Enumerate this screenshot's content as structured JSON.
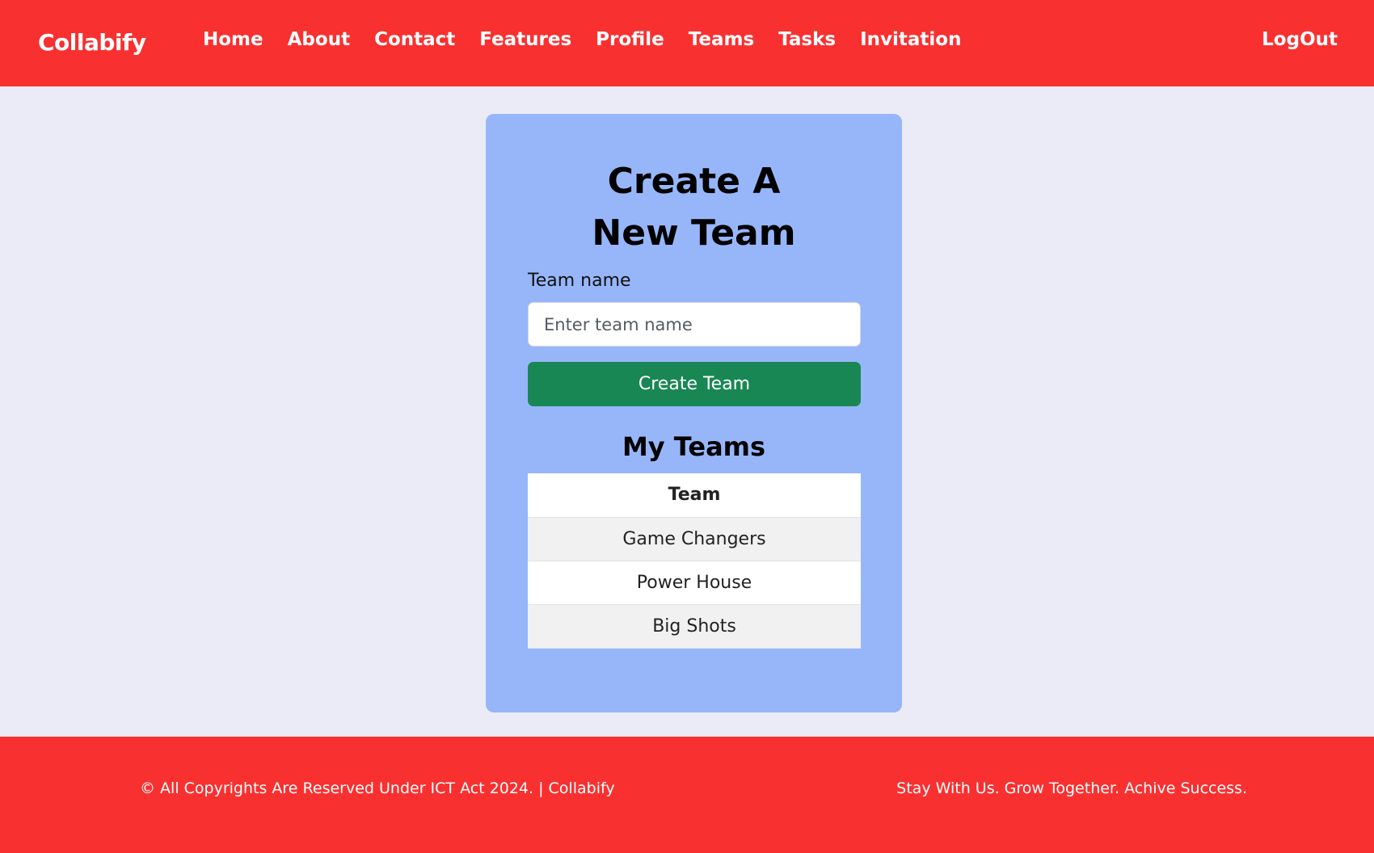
{
  "navbar": {
    "brand": "Collabify",
    "links": [
      "Home",
      "About",
      "Contact",
      "Features",
      "Profile",
      "Teams",
      "Tasks",
      "Invitation"
    ],
    "logout": "LogOut"
  },
  "form": {
    "title": "Create A New Team",
    "team_name_label": "Team name",
    "team_name_placeholder": "Enter team name",
    "team_name_value": "",
    "submit_label": "Create Team"
  },
  "my_teams": {
    "heading": "My Teams",
    "column_header": "Team",
    "rows": [
      "Game Changers",
      "Power House",
      "Big Shots"
    ]
  },
  "footer": {
    "left_text": "© All Copyrights Are Reserved Under ICT Act 2024. | Collabify",
    "right_text": "Stay With Us. Grow Together. Achive Success."
  },
  "colors": {
    "navbar_bg": "#f93030",
    "card_bg": "#97b6fa",
    "button_bg": "#198754",
    "page_bg": "#eaebf6"
  }
}
